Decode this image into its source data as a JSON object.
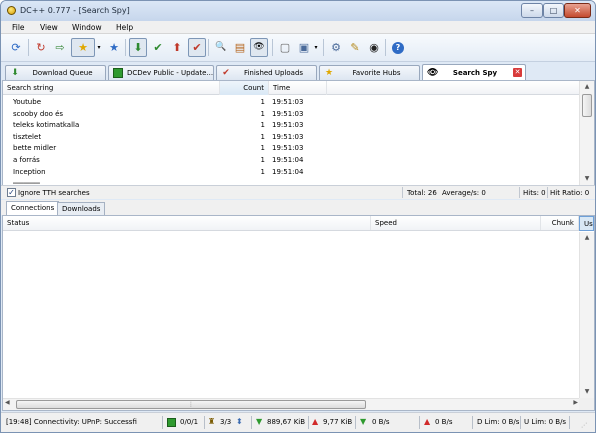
{
  "window": {
    "title": "DC++ 0.777 - [Search Spy]",
    "btn_minimize": "–",
    "btn_maximize": "□",
    "btn_close": "✕"
  },
  "menu": [
    "File",
    "View",
    "Window",
    "Help"
  ],
  "toolbar_icons": [
    {
      "name": "connect-icon",
      "glyph": "⟳"
    },
    {
      "name": "reconnect-icon",
      "glyph": "↻"
    },
    {
      "name": "follow-redirect-icon",
      "glyph": "⇨"
    },
    {
      "name": "favorite-hubs-icon",
      "glyph": "★"
    },
    {
      "name": "favorite-users-icon",
      "glyph": "★"
    },
    {
      "name": "queue-icon",
      "glyph": "⬇"
    },
    {
      "name": "finished-downloads-icon",
      "glyph": "✔"
    },
    {
      "name": "upload-queue-icon",
      "glyph": "⬆"
    },
    {
      "name": "finished-uploads-icon",
      "glyph": "✔"
    },
    {
      "name": "search-icon",
      "glyph": "🔍"
    },
    {
      "name": "adl-search-icon",
      "glyph": "▤"
    },
    {
      "name": "search-spy-icon",
      "glyph": "👁"
    },
    {
      "name": "open-file-list-icon",
      "glyph": "▢"
    },
    {
      "name": "recent-hubs-icon",
      "glyph": "▣"
    },
    {
      "name": "settings-icon",
      "glyph": "⚙"
    },
    {
      "name": "notepad-icon",
      "glyph": "✎"
    },
    {
      "name": "hash-progress-icon",
      "glyph": "◉"
    },
    {
      "name": "help-icon",
      "glyph": "?"
    }
  ],
  "tabs": [
    {
      "label": "Download Queue",
      "icon": "queue-icon"
    },
    {
      "label": "DCDev Public - Update...",
      "icon": "hub-icon"
    },
    {
      "label": "Finished Uploads",
      "icon": "finished-uploads-icon"
    },
    {
      "label": "Favorite Hubs",
      "icon": "favorite-hubs-icon"
    },
    {
      "label": "Search Spy",
      "icon": "search-spy-icon",
      "active": true
    }
  ],
  "search_spy": {
    "columns": {
      "search_string": "Search string",
      "count": "Count",
      "time": "Time"
    },
    "rows": [
      {
        "search_string": "Youtube",
        "count": "1",
        "time": "19:51:03"
      },
      {
        "search_string": "scooby doo és",
        "count": "1",
        "time": "19:51:03"
      },
      {
        "search_string": "teleks kotimatkalla",
        "count": "1",
        "time": "19:51:03"
      },
      {
        "search_string": "tisztelet",
        "count": "1",
        "time": "19:51:03"
      },
      {
        "search_string": "bette midler",
        "count": "1",
        "time": "19:51:03"
      },
      {
        "search_string": "a forrás",
        "count": "1",
        "time": "19:51:04"
      },
      {
        "search_string": "Inception",
        "count": "1",
        "time": "19:51:04"
      }
    ]
  },
  "spy_status": {
    "ignore_tth": "Ignore TTH searches",
    "ignore_tth_checked": true,
    "total": "Total: 26",
    "average": "Average/s: 0",
    "hits": "Hits: 0",
    "hit_ratio": "Hit Ratio: 0"
  },
  "bottom_tabs": [
    {
      "label": "Connections",
      "active": true
    },
    {
      "label": "Downloads"
    }
  ],
  "transfers": {
    "columns": {
      "status": "Status",
      "speed": "Speed",
      "chunk": "Chunk",
      "user": "Us"
    }
  },
  "statusbar": {
    "message": "[19:48] Connectivity: UPnP: Successfi",
    "hubs": "0/0/1",
    "slots": "3/3",
    "downloaded": "889,67 KiB",
    "uploaded": "9,77 KiB",
    "down_speed": "0 B/s",
    "up_speed": "0 B/s",
    "down_limit": "D Lim: 0 B/s",
    "up_limit": "U Lim: 0 B/s"
  }
}
